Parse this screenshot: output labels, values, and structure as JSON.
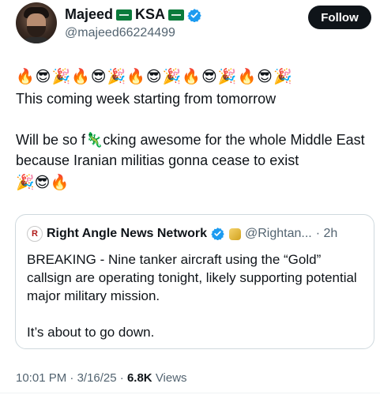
{
  "author": {
    "name": "Majeed",
    "name_suffix": "KSA",
    "handle": "@majeed66224499",
    "follow_label": "Follow"
  },
  "tweet": {
    "emoji_line": "🔥😎🎉🔥😎🎉🔥😎🎉🔥😎🎉🔥😎🎉",
    "text": "This coming week starting from tomorrow\n\nWill be so f🦎cking awesome for the whole Middle East because Iranian militias gonna cease to exist",
    "trailing_emoji": "🎉😎🔥"
  },
  "quoted": {
    "logo_letter": "R",
    "name": "Right Angle News Network",
    "handle": "@Rightan...",
    "time": "· 2h",
    "text": "BREAKING - Nine tanker aircraft using the “Gold” callsign are operating tonight, likely supporting potential major military mission.\n\nIt’s about to go down."
  },
  "meta": {
    "time": "10:01 PM",
    "date": "3/16/25",
    "views_count": "6.8K",
    "views_label": "Views"
  },
  "colors": {
    "verified_blue": "#1d9bf0",
    "flag_green": "#0b7a3b",
    "follow_bg": "#0f1419"
  }
}
